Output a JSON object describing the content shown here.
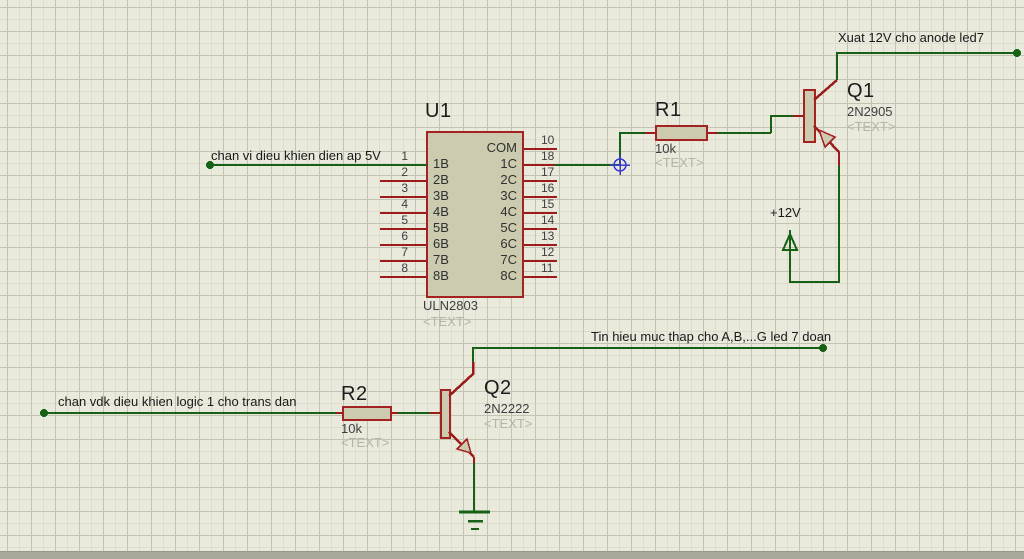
{
  "schematic": {
    "components": {
      "u1": {
        "ref": "U1",
        "value": "ULN2803",
        "placeholder": "<TEXT>",
        "left_pins": [
          {
            "num": "1",
            "label": "1B"
          },
          {
            "num": "2",
            "label": "2B"
          },
          {
            "num": "3",
            "label": "3B"
          },
          {
            "num": "4",
            "label": "4B"
          },
          {
            "num": "5",
            "label": "5B"
          },
          {
            "num": "6",
            "label": "6B"
          },
          {
            "num": "7",
            "label": "7B"
          },
          {
            "num": "8",
            "label": "8B"
          }
        ],
        "right_pins": [
          {
            "num": "10",
            "label": "COM"
          },
          {
            "num": "18",
            "label": "1C"
          },
          {
            "num": "17",
            "label": "2C"
          },
          {
            "num": "16",
            "label": "3C"
          },
          {
            "num": "15",
            "label": "4C"
          },
          {
            "num": "14",
            "label": "5C"
          },
          {
            "num": "13",
            "label": "6C"
          },
          {
            "num": "12",
            "label": "7C"
          },
          {
            "num": "11",
            "label": "8C"
          }
        ]
      },
      "r1": {
        "ref": "R1",
        "value": "10k",
        "placeholder": "<TEXT>"
      },
      "r2": {
        "ref": "R2",
        "value": "10k",
        "placeholder": "<TEXT>"
      },
      "q1": {
        "ref": "Q1",
        "value": "2N2905",
        "placeholder": "<TEXT>"
      },
      "q2": {
        "ref": "Q2",
        "value": "2N2222",
        "placeholder": "<TEXT>"
      }
    },
    "labels": {
      "input_5v": "chan vi dieu khien dien ap 5V",
      "out_12v": "Xuat 12V cho anode led7",
      "power_rail": "+12V",
      "low_signal": "Tin hieu muc thap cho A,B,...G led 7 doan",
      "logic1": "chan vdk dieu khien logic 1 cho trans dan"
    },
    "colors": {
      "wire": "#166116",
      "component_outline": "#a32222",
      "pin_stub": "#9b1b1b",
      "component_fill": "#cccbb0",
      "junction_marker": "#3b3bd0",
      "background": "#e9e9dc"
    }
  }
}
